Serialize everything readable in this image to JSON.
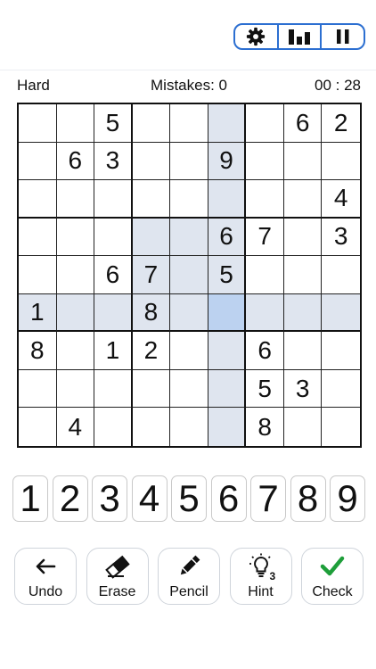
{
  "header": {
    "settings_icon": "gear-icon",
    "stats_icon": "bar-chart-icon",
    "pause_icon": "pause-icon",
    "accent": "#2c6fd1"
  },
  "status": {
    "difficulty": "Hard",
    "mistakes": "Mistakes: 0",
    "timer": "00 : 28"
  },
  "board": {
    "selected": {
      "row": 5,
      "col": 5
    },
    "highlight_color": "#dfe5ef",
    "selected_color": "#bcd2f0",
    "grid": [
      [
        "",
        "",
        "5",
        "",
        "",
        "",
        "",
        "6",
        "2"
      ],
      [
        "",
        "6",
        "3",
        "",
        "",
        "9",
        "",
        "",
        ""
      ],
      [
        "",
        "",
        "",
        "",
        "",
        "",
        "",
        "",
        "4"
      ],
      [
        "",
        "",
        "",
        "",
        "",
        "6",
        "7",
        "",
        "3"
      ],
      [
        "",
        "",
        "6",
        "7",
        "",
        "5",
        "",
        "",
        ""
      ],
      [
        "1",
        "",
        "",
        "8",
        "",
        "",
        "",
        "",
        ""
      ],
      [
        "8",
        "",
        "1",
        "2",
        "",
        "",
        "6",
        "",
        ""
      ],
      [
        "",
        "",
        "",
        "",
        "",
        "",
        "5",
        "3",
        ""
      ],
      [
        "",
        "4",
        "",
        "",
        "",
        "",
        "8",
        "",
        ""
      ]
    ]
  },
  "numpad": [
    "1",
    "2",
    "3",
    "4",
    "5",
    "6",
    "7",
    "8",
    "9"
  ],
  "actions": [
    {
      "label": "Undo",
      "icon": "undo-arrow-icon"
    },
    {
      "label": "Erase",
      "icon": "eraser-icon"
    },
    {
      "label": "Pencil",
      "icon": "pencil-icon"
    },
    {
      "label": "Hint",
      "icon": "lightbulb-icon",
      "badge": "3"
    },
    {
      "label": "Check",
      "icon": "checkmark-icon",
      "icon_color": "#1e9e3a"
    }
  ]
}
